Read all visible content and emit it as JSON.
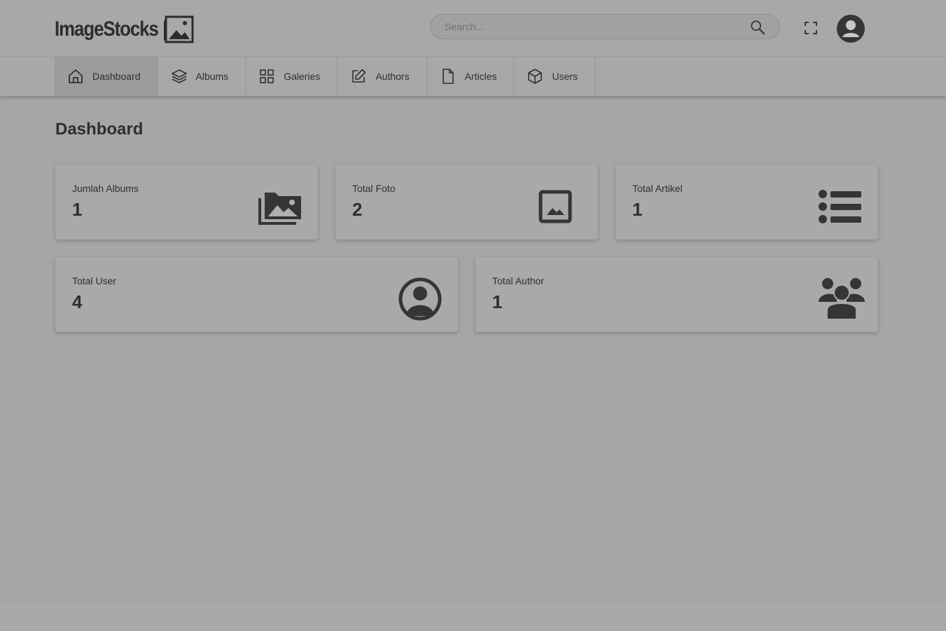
{
  "app": {
    "logo_text": "ImageStocks |",
    "search_placeholder": "Search..."
  },
  "nav": {
    "items": [
      {
        "label": "Dashboard",
        "icon": "home-icon",
        "active": true
      },
      {
        "label": "Albums",
        "icon": "layers-icon"
      },
      {
        "label": "Galeries",
        "icon": "grid-icon"
      },
      {
        "label": "Authors",
        "icon": "edit-icon"
      },
      {
        "label": "Articles",
        "icon": "file-icon"
      },
      {
        "label": "Users",
        "icon": "box-icon"
      }
    ]
  },
  "page": {
    "title": "Dashboard"
  },
  "cards": [
    {
      "label": "Jumlah Albums",
      "value": "1",
      "icon": "photo-albums-icon"
    },
    {
      "label": "Total Foto",
      "value": "2",
      "icon": "image-icon"
    },
    {
      "label": "Total Artikel",
      "value": "1",
      "icon": "list-icon"
    },
    {
      "label": "Total User",
      "value": "4",
      "icon": "user-circle-icon"
    },
    {
      "label": "Total Author",
      "value": "1",
      "icon": "users-group-icon"
    }
  ],
  "colors": {
    "background": "#a6a6a6",
    "text": "#2e2e2e",
    "active_nav": "#9c9c9c"
  }
}
